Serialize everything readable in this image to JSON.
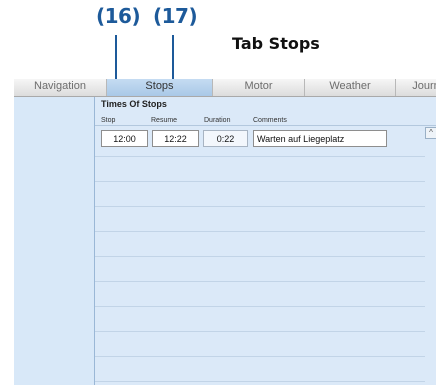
{
  "callouts": [
    "(16)",
    "(17)"
  ],
  "page_heading": "Tab Stops",
  "tabs": [
    {
      "label": "Navigation",
      "active": false
    },
    {
      "label": "Stops",
      "active": true
    },
    {
      "label": "Motor",
      "active": false
    },
    {
      "label": "Weather",
      "active": false
    },
    {
      "label": "Journ",
      "active": false
    }
  ],
  "section_title": "Times Of Stops",
  "columns": {
    "stop": "Stop",
    "resume": "Resume",
    "duration": "Duration",
    "comments": "Comments"
  },
  "entry": {
    "stop": "12:00",
    "resume": "12:22",
    "duration": "0:22",
    "comment": "Warten auf Liegeplatz"
  },
  "scroll_glyph": "^"
}
